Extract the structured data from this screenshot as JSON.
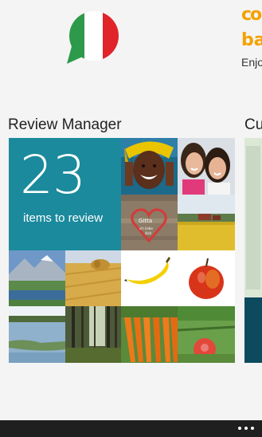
{
  "header": {
    "flag_icon": "italian-flag-speech-bubble-icon",
    "brand_line1": "co",
    "brand_line2": "ba",
    "brand_tagline": "Enjo",
    "brand_color": "#f5a100"
  },
  "sections": {
    "review_title": "Review Manager",
    "next_title": "Cu"
  },
  "review": {
    "count": "23",
    "label": "items to review",
    "tile_color": "#1b8a9c"
  },
  "photos": [
    "smiling-woman-photo",
    "two-girls-photo",
    "heart-carving-photo",
    "farm-field-photo",
    "mountain-lake-photo",
    "hay-bale-field-photo",
    "banana-photo",
    "red-apple-photo",
    "lake-shore-photo",
    "forest-photo",
    "carrots-photo",
    "garden-tomatoes-photo"
  ],
  "heart_text": "Gitta ich liebe dich",
  "appbar": {
    "more_icon": "ellipsis-icon"
  }
}
